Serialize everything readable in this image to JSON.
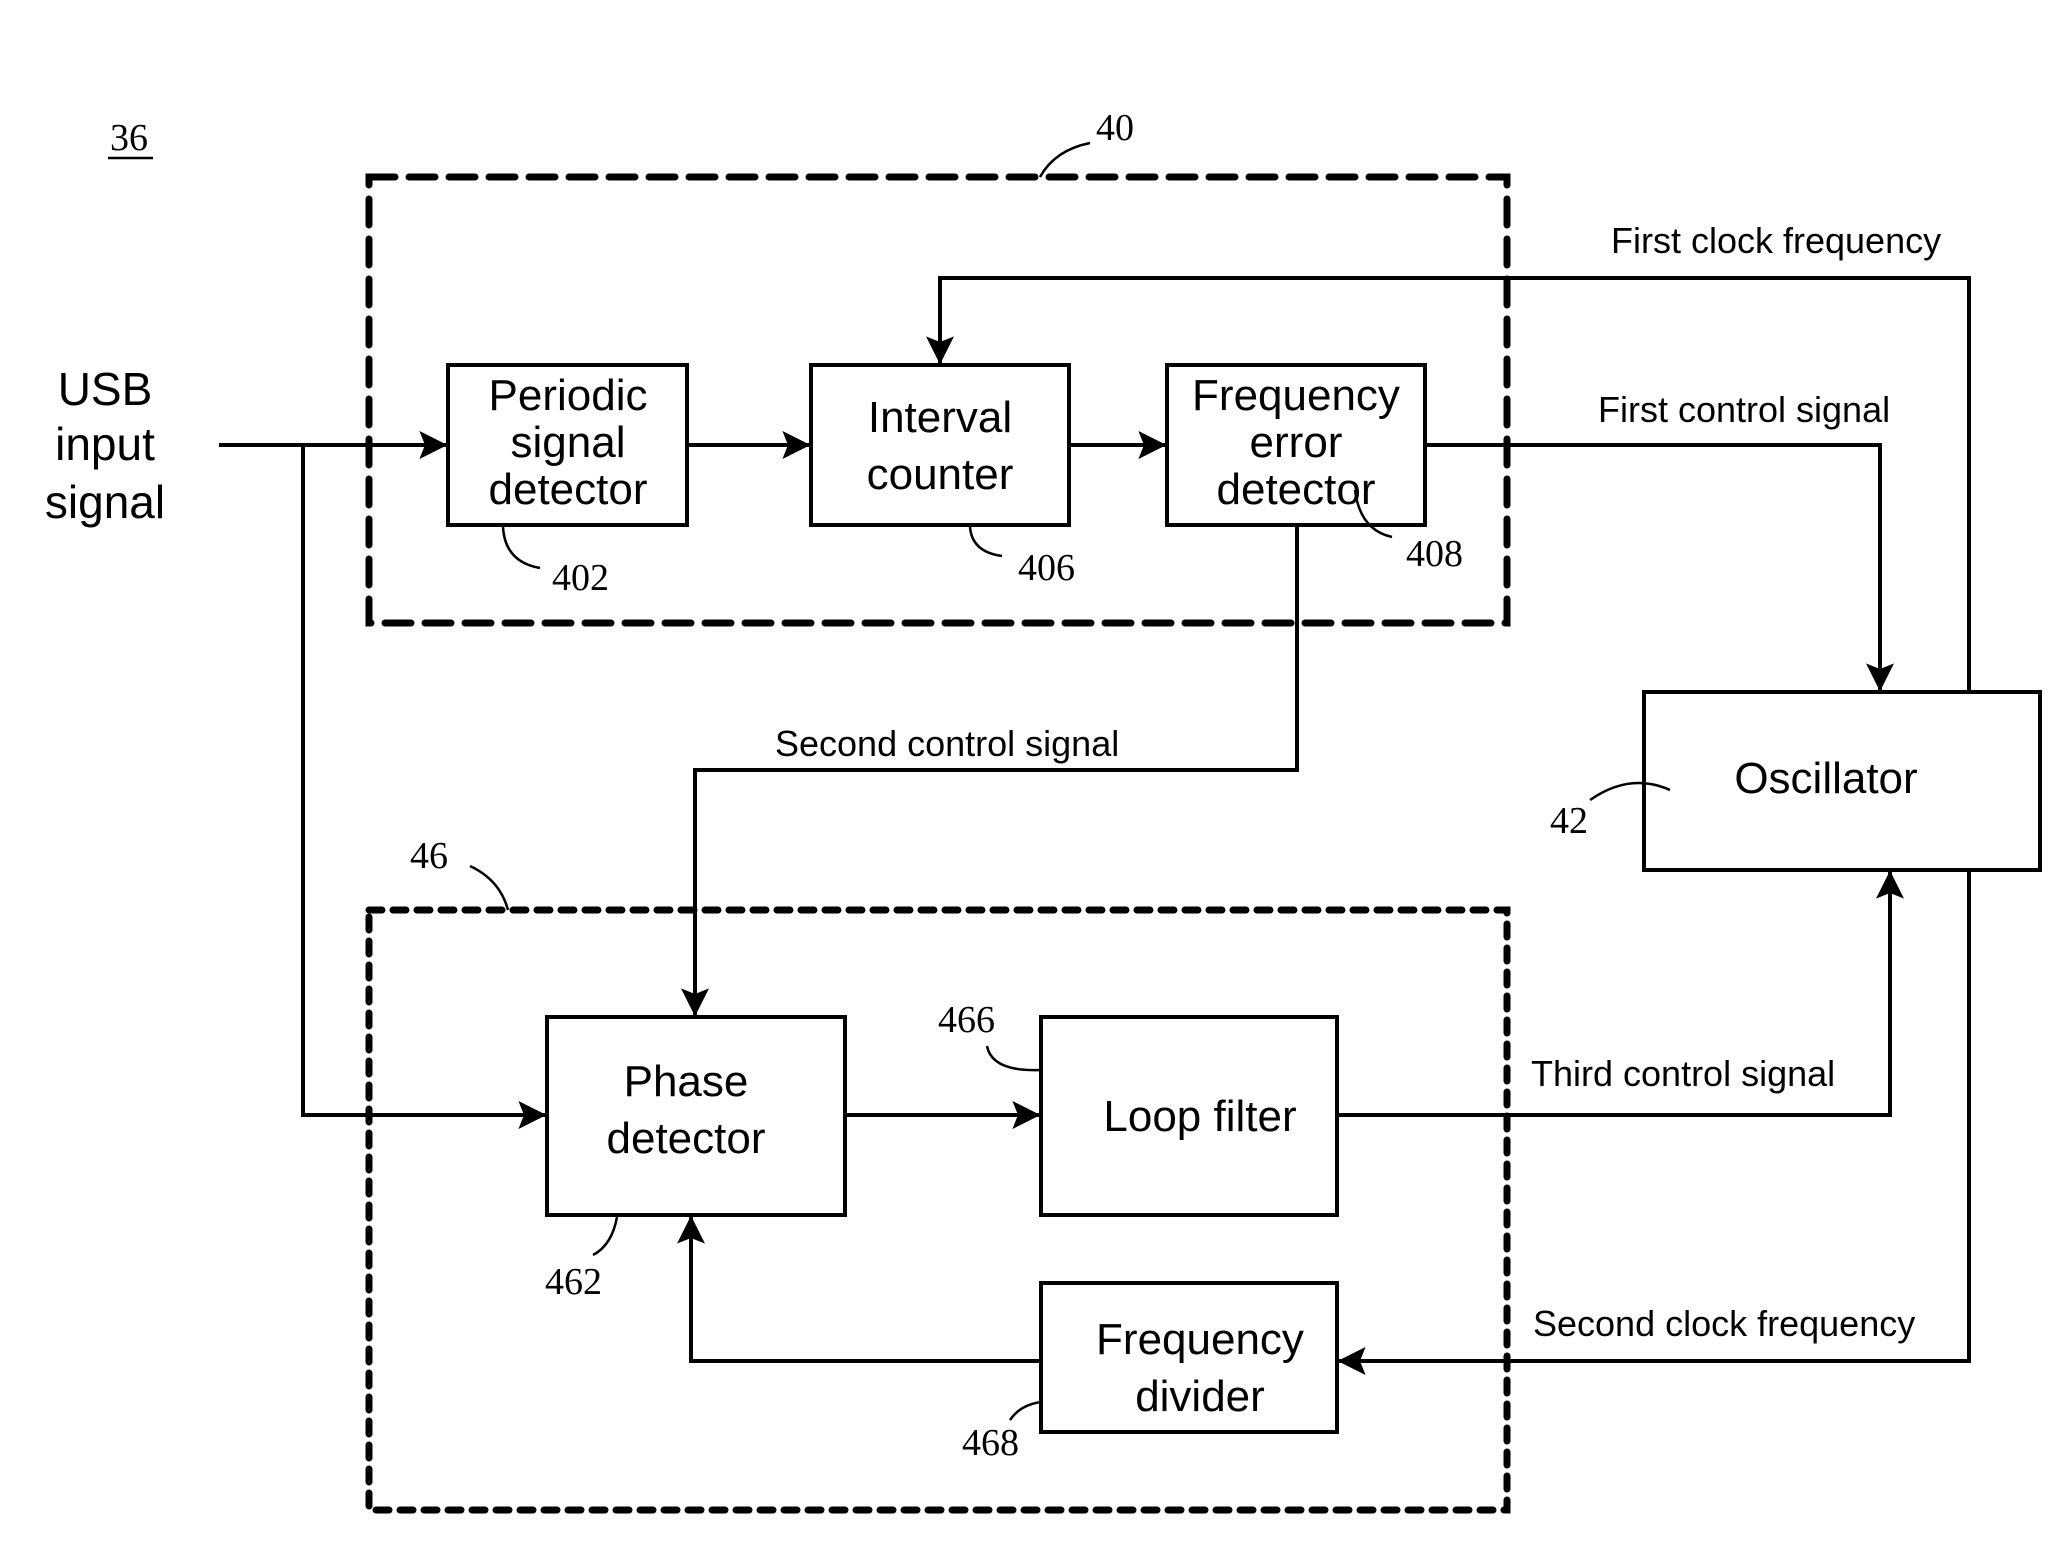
{
  "figure": {
    "figure_ref": "36",
    "input_label": [
      "USB",
      "input",
      "signal"
    ]
  },
  "groups": {
    "frequency_group": {
      "ref": "40"
    },
    "phase_group": {
      "ref": "46"
    }
  },
  "blocks": {
    "periodic_signal_detector": {
      "lines": [
        "Periodic",
        "signal",
        "detector"
      ],
      "ref": "402"
    },
    "interval_counter": {
      "lines": [
        "Interval",
        "counter"
      ],
      "ref": "406"
    },
    "frequency_error_detector": {
      "lines": [
        "Frequency",
        "error",
        "detector"
      ],
      "ref": "408"
    },
    "oscillator": {
      "lines": [
        "Oscillator"
      ],
      "ref": "42"
    },
    "phase_detector": {
      "lines": [
        "Phase",
        "detector"
      ],
      "ref": "462"
    },
    "loop_filter": {
      "lines": [
        "Loop filter"
      ],
      "ref": "466"
    },
    "frequency_divider": {
      "lines": [
        "Frequency",
        "divider"
      ],
      "ref": "468"
    }
  },
  "signals": {
    "first_clock_frequency": "First clock frequency",
    "first_control_signal": "First control signal",
    "second_control_signal": "Second control signal",
    "third_control_signal": "Third control signal",
    "second_clock_frequency": "Second clock frequency"
  }
}
